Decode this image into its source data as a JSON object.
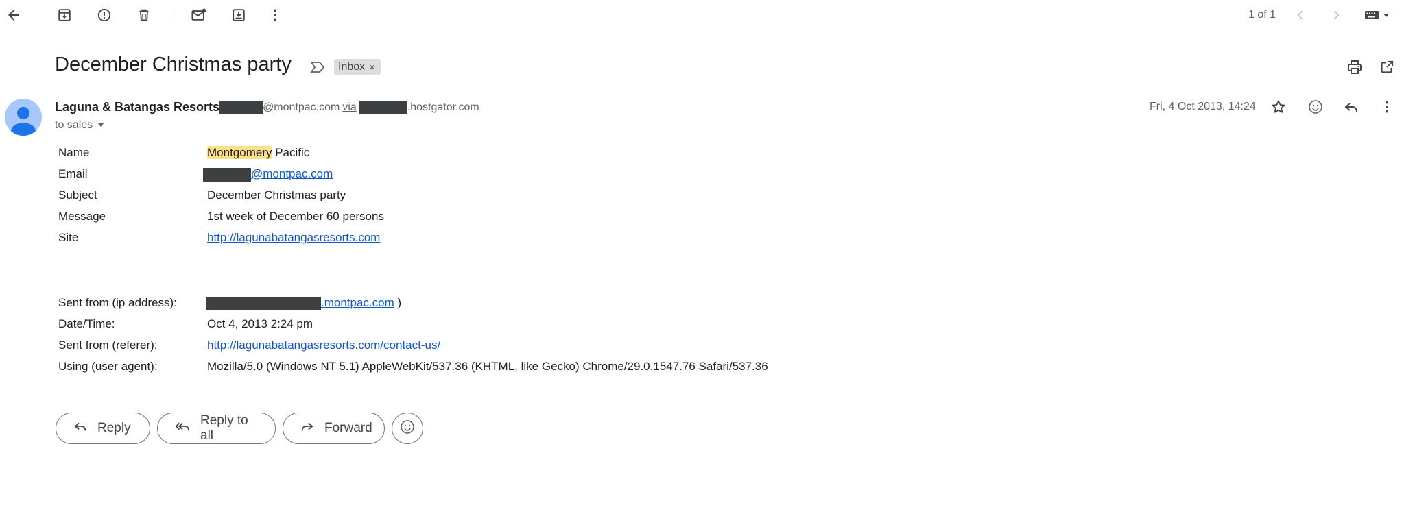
{
  "toolbar": {
    "pagination": "1 of 1"
  },
  "message": {
    "subject": "December Christmas party",
    "label_chip": "Inbox",
    "label_chip_close": "×",
    "sender_name": "Laguna & Batangas Resorts",
    "sender_email_suffix": "@montpac.com",
    "via_text": "via",
    "via_domain_suffix": ".hostgator.com",
    "recipient_line": "to sales",
    "date": "Fri, 4 Oct 2013, 14:24"
  },
  "form_fields": [
    {
      "label": "Name",
      "value_highlight": "Montgomery",
      "value_rest": " Pacific"
    },
    {
      "label": "Email",
      "value": "@montpac.com"
    },
    {
      "label": "Subject",
      "value": "December Christmas party"
    },
    {
      "label": "Message",
      "value": "1st week of December 60 persons"
    },
    {
      "label": "Site",
      "value": "http://lagunabatangasresorts.com"
    }
  ],
  "meta_fields": [
    {
      "label": "Sent from (ip address):",
      "value": ".montpac.com",
      "value_suffix": " )"
    },
    {
      "label": "Date/Time:",
      "value": "Oct 4, 2013 2:24 pm"
    },
    {
      "label": "Sent from (referer):",
      "value": "http://lagunabatangasresorts.com/contact-us/"
    },
    {
      "label": "Using (user agent):",
      "value": "Mozilla/5.0 (Windows NT 5.1) AppleWebKit/537.36 (KHTML, like Gecko) Chrome/29.0.1547.76 Safari/537.36"
    }
  ],
  "actions": {
    "reply": "Reply",
    "reply_all": "Reply to all",
    "forward": "Forward"
  },
  "icons": {
    "back": "arrow-back-icon",
    "archive": "archive-icon",
    "spam": "report-spam-icon",
    "delete": "trash-icon",
    "unread": "mark-unread-icon",
    "move": "move-to-icon",
    "more": "more-vert-icon",
    "print": "print-icon",
    "open_new": "open-in-new-icon",
    "star": "star-icon",
    "emoji": "emoji-icon",
    "reply": "reply-icon"
  },
  "colors": {
    "link": "#1155cc",
    "highlight": "#ffe08a",
    "avatar": "#a8c7fa",
    "avatar_figure": "#1a73e8",
    "chip": "#dddddd"
  }
}
